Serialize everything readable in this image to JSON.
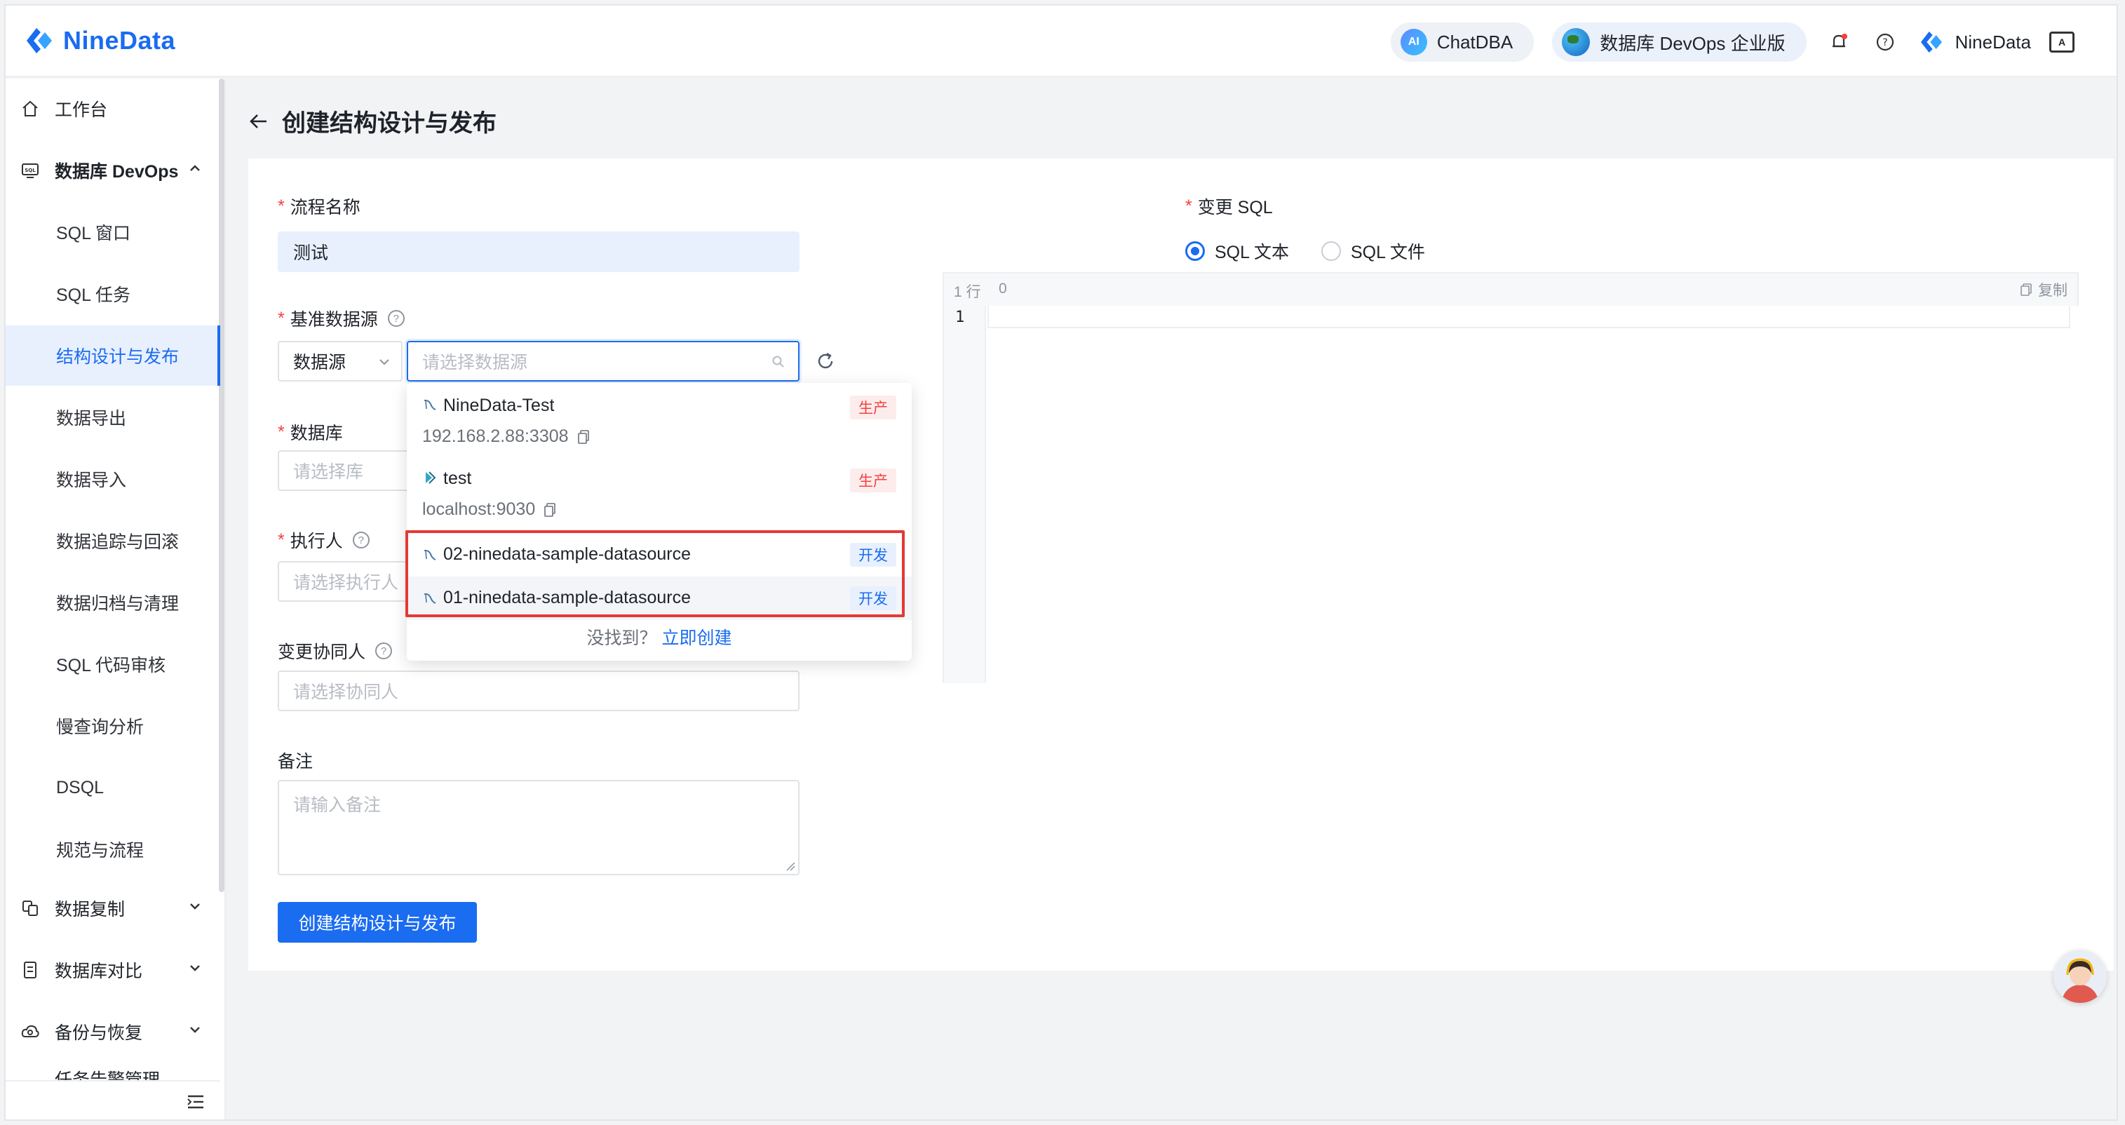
{
  "header": {
    "brand": "NineData",
    "chatdba_label": "ChatDBA",
    "ai_badge": "AI",
    "edition_label": "数据库 DevOps 企业版",
    "user_name": "NineData",
    "lang_icon_text": "A"
  },
  "sidebar": {
    "workbench": "工作台",
    "devops_group": "数据库 DevOps",
    "items": [
      "SQL 窗口",
      "SQL 任务",
      "结构设计与发布",
      "数据导出",
      "数据导入",
      "数据追踪与回滚",
      "数据归档与清理",
      "SQL 代码审核",
      "慢查询分析",
      "DSQL",
      "规范与流程"
    ],
    "groups": [
      "数据复制",
      "数据库对比",
      "备份与恢复",
      "任务告警管理"
    ]
  },
  "page": {
    "title": "创建结构设计与发布"
  },
  "form": {
    "flow_name_label": "流程名称",
    "flow_name_value": "测试",
    "base_datasource_label": "基准数据源",
    "datasource_type": "数据源",
    "datasource_placeholder": "请选择数据源",
    "database_label": "数据库",
    "database_placeholder": "请选择库",
    "executor_label": "执行人",
    "executor_placeholder": "请选择执行人",
    "collaborator_label": "变更协同人",
    "collaborator_placeholder": "请选择协同人",
    "remark_label": "备注",
    "remark_placeholder": "请输入备注",
    "submit_label": "创建结构设计与发布"
  },
  "dropdown": {
    "items": [
      {
        "name": "NineData-Test",
        "address": "192.168.2.88:3308",
        "tag": "生产"
      },
      {
        "name": "test",
        "address": "localhost:9030",
        "tag": "生产"
      },
      {
        "name": "02-ninedata-sample-datasource",
        "tag": "开发"
      },
      {
        "name": "01-ninedata-sample-datasource",
        "tag": "开发"
      }
    ],
    "not_found": "没找到？",
    "create_link": "立即创建"
  },
  "sql": {
    "label": "变更 SQL",
    "option_text": "SQL 文本",
    "option_file": "SQL 文件",
    "selected": "SQL 文本",
    "status_row": "1 行",
    "status_col": "0",
    "copy_label": "复制",
    "line_number": "1"
  },
  "colors": {
    "primary": "#1a6cf0",
    "prod_tag": "#f53f3f",
    "highlight_border": "#e53935"
  }
}
